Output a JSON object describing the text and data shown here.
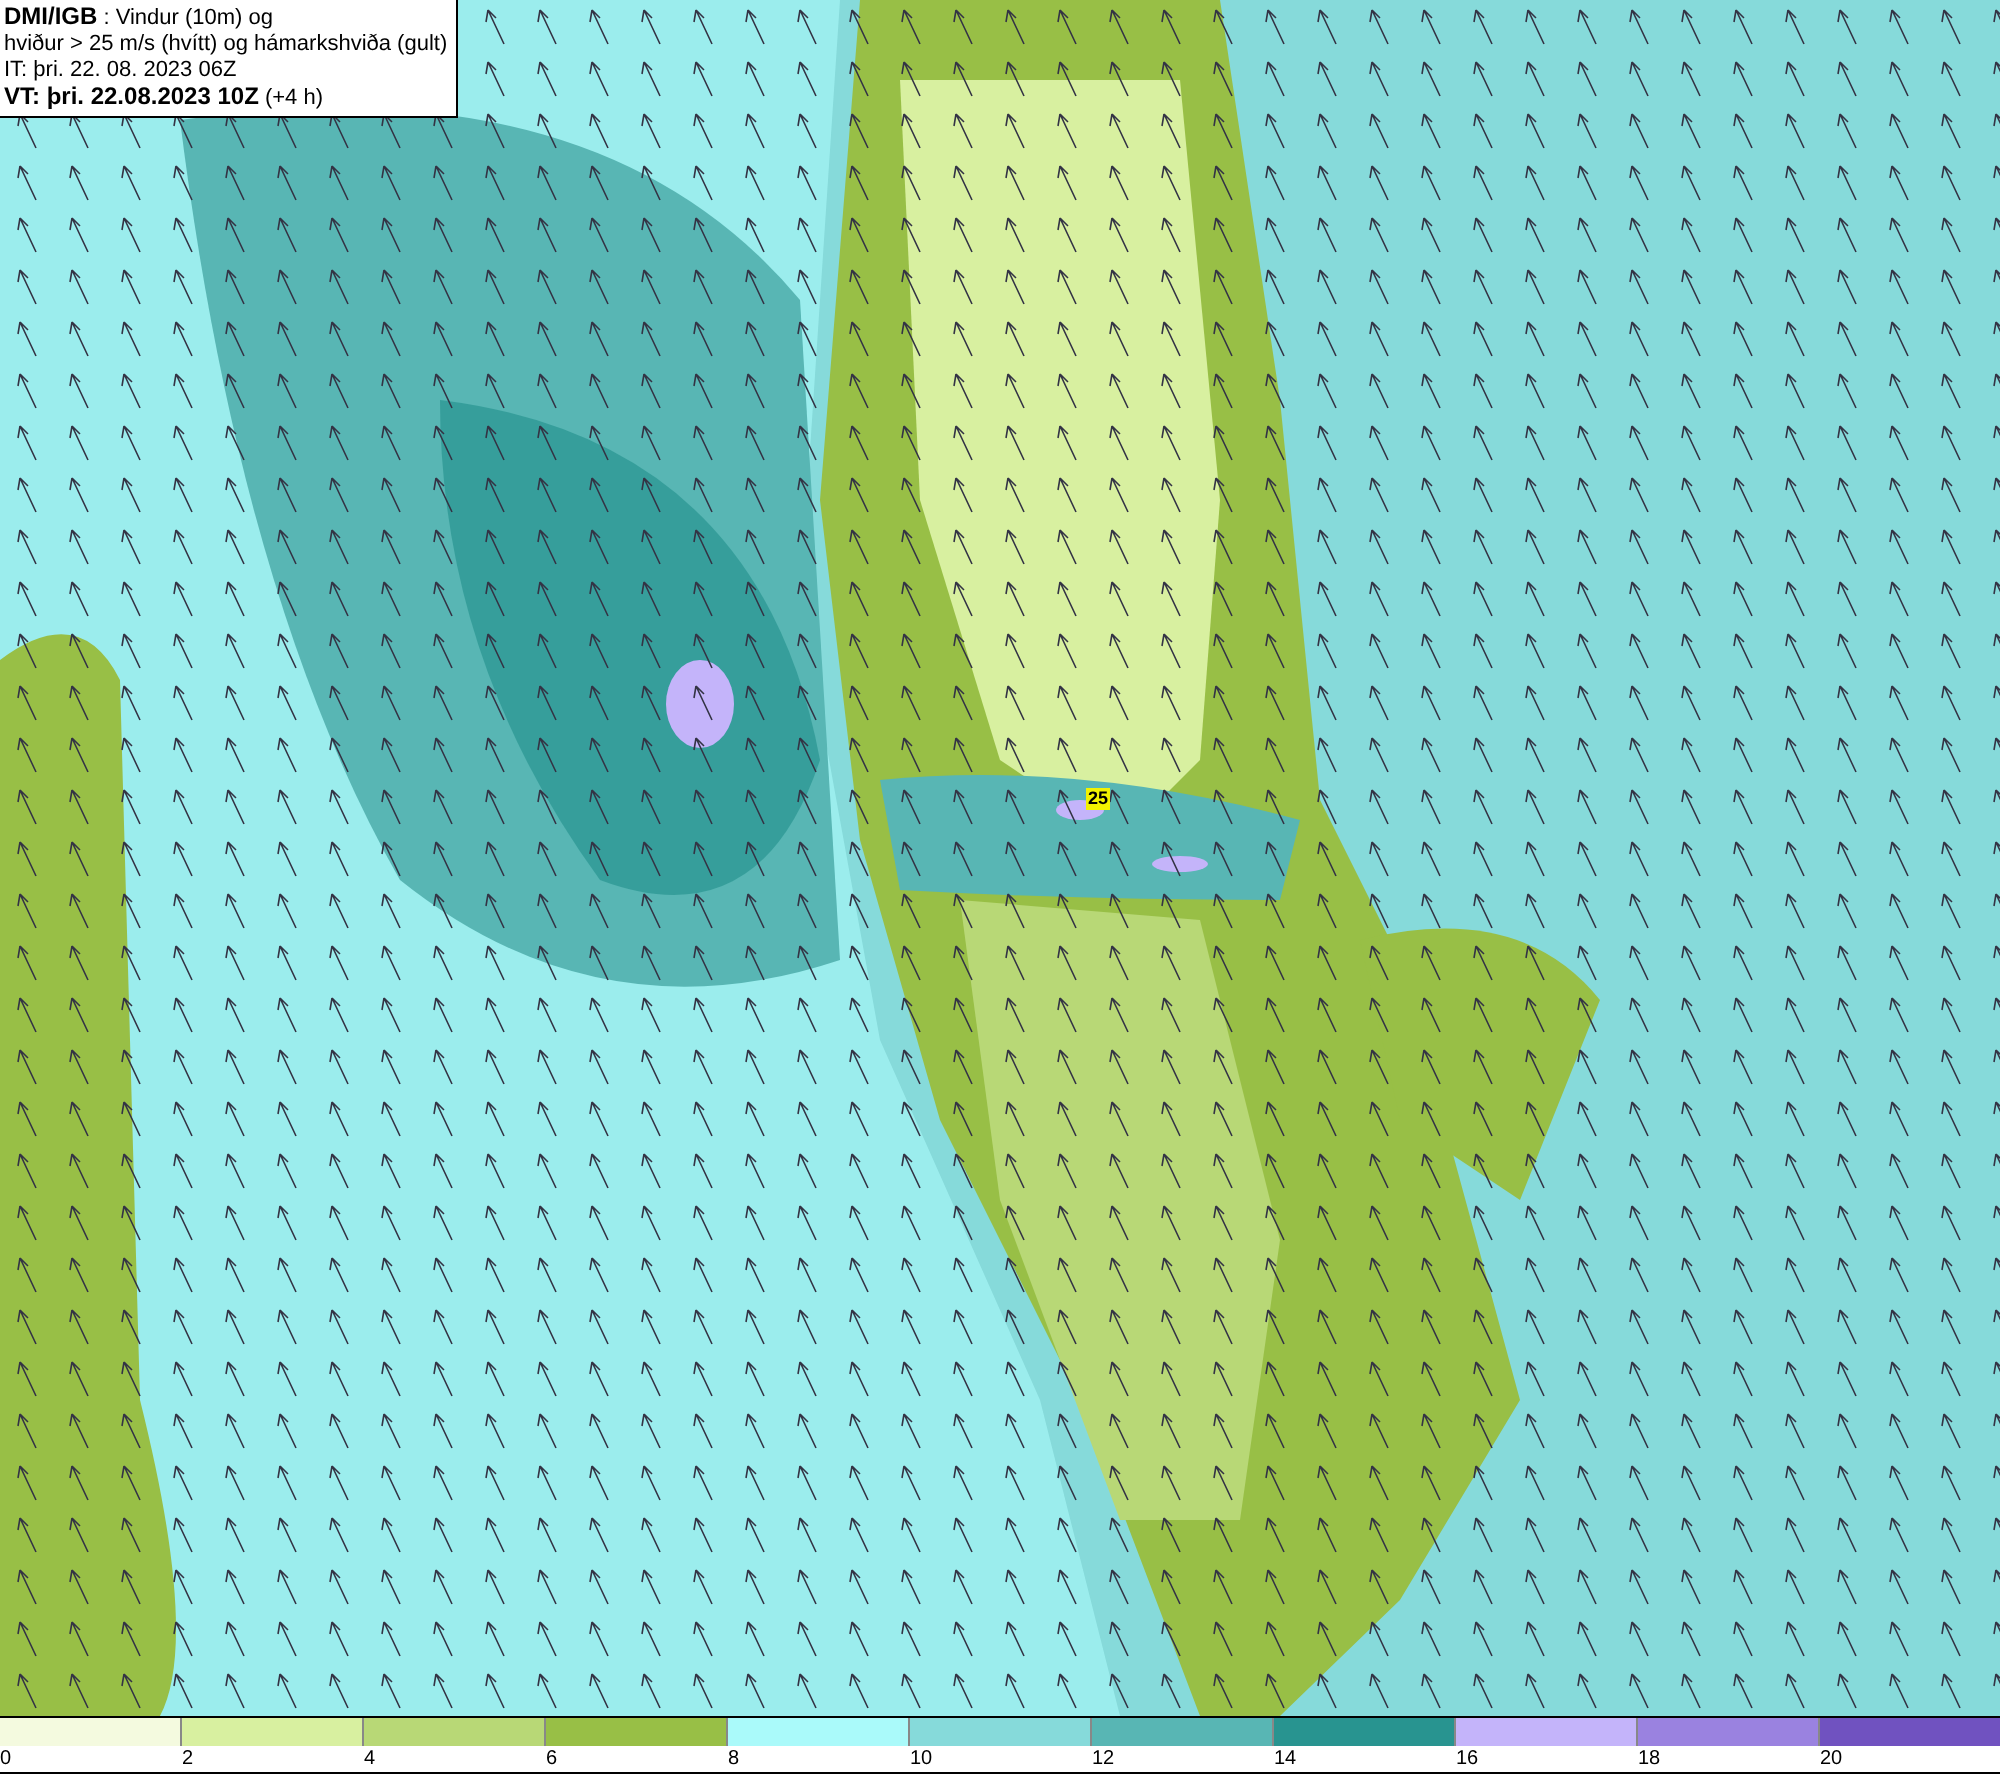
{
  "header": {
    "lines": [
      "**DMI/IGB** : Vindur (10m) og",
      "hviður > 25 m/s (hvítt) og hámarkshviða (gult)",
      "IT: þri. 22. 08. 2023 06Z",
      "**VT: þri. 22.08.2023 10Z** (+4 h)"
    ]
  },
  "map": {
    "gust_label": "25"
  },
  "legend": {
    "bins": [
      {
        "label": "0",
        "color": "#f4fadf"
      },
      {
        "label": "2",
        "color": "#d8f0a0"
      },
      {
        "label": "4",
        "color": "#b8d876"
      },
      {
        "label": "6",
        "color": "#98bf46"
      },
      {
        "label": "8",
        "color": "#aafafa"
      },
      {
        "label": "10",
        "color": "#86dada"
      },
      {
        "label": "12",
        "color": "#58b6b4"
      },
      {
        "label": "14",
        "color": "#289490"
      },
      {
        "label": "16",
        "color": "#c4b4fa"
      },
      {
        "label": "18",
        "color": "#9a82e0"
      },
      {
        "label": "20",
        "color": "#7052c0"
      }
    ]
  }
}
